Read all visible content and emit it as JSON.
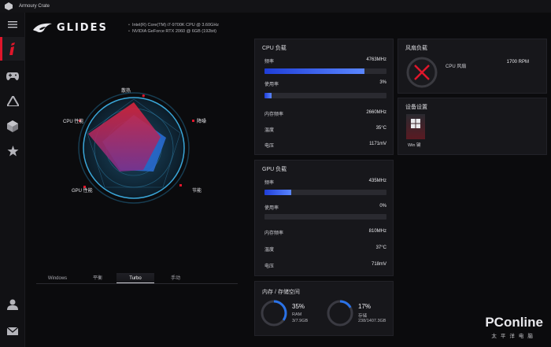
{
  "window": {
    "title": "Armoury Crate"
  },
  "header": {
    "brand": "GLIDES",
    "cpu_info": "Intel(R) Core(TM) i7-9700K CPU @ 3.60GHz",
    "gpu_info": "NVIDIA GeForce RTX 2060 @ 6GB (192bit)"
  },
  "sidebar": {
    "items": [
      {
        "name": "menu",
        "icon": "hamburger-menu-icon"
      },
      {
        "name": "home",
        "icon": "rog-i-icon",
        "active": true
      },
      {
        "name": "gamepad",
        "icon": "gamepad-icon"
      },
      {
        "name": "aura",
        "icon": "triangle-icon"
      },
      {
        "name": "device",
        "icon": "cube-icon"
      },
      {
        "name": "favorites",
        "icon": "star-icon"
      },
      {
        "name": "user",
        "icon": "user-icon"
      },
      {
        "name": "mail",
        "icon": "mail-icon"
      }
    ]
  },
  "radar": {
    "labels": [
      "散热",
      "降噪",
      "节能",
      "GPU 性能",
      "CPU 性能"
    ],
    "accent": "#e0162b"
  },
  "modes": {
    "tabs": [
      "Windows",
      "平衡",
      "Turbo",
      "手动"
    ],
    "active_index": 2
  },
  "cpu": {
    "title": "CPU 负载",
    "frequency_label": "频率",
    "frequency": "4763MHz",
    "frequency_pct": 0.82,
    "usage_label": "使用率",
    "usage": "3%",
    "usage_pct": 0.03,
    "mem_freq_label": "内存频率",
    "mem_freq": "2660MHz",
    "temp_label": "温度",
    "temp": "35°C",
    "voltage_label": "电压",
    "voltage": "1171mV"
  },
  "gpu": {
    "title": "GPU 负载",
    "frequency_label": "频率",
    "frequency": "435MHz",
    "frequency_pct": 0.22,
    "usage_label": "使用率",
    "usage": "0%",
    "usage_pct": 0.0,
    "mem_freq_label": "内存频率",
    "mem_freq": "810MHz",
    "temp_label": "温度",
    "temp": "37°C",
    "voltage_label": "电压",
    "voltage": "718mV"
  },
  "memory": {
    "title": "内存 / 存储空间",
    "ram_pct": "35%",
    "ram_label": "RAM",
    "ram_detail": "3/7.9GB",
    "ram_value": 0.35,
    "storage_pct": "17%",
    "storage_label": "存储",
    "storage_detail": "238/1407.3GB",
    "storage_value": 0.17
  },
  "fan": {
    "title": "风扇负载",
    "cpu_fan_label": "CPU 风扇",
    "cpu_fan_value": "1700 RPM"
  },
  "device": {
    "title": "设备设置",
    "win_key_label": "Win 键"
  },
  "watermark": {
    "main": "PConline",
    "sub": "太平洋电脑"
  }
}
